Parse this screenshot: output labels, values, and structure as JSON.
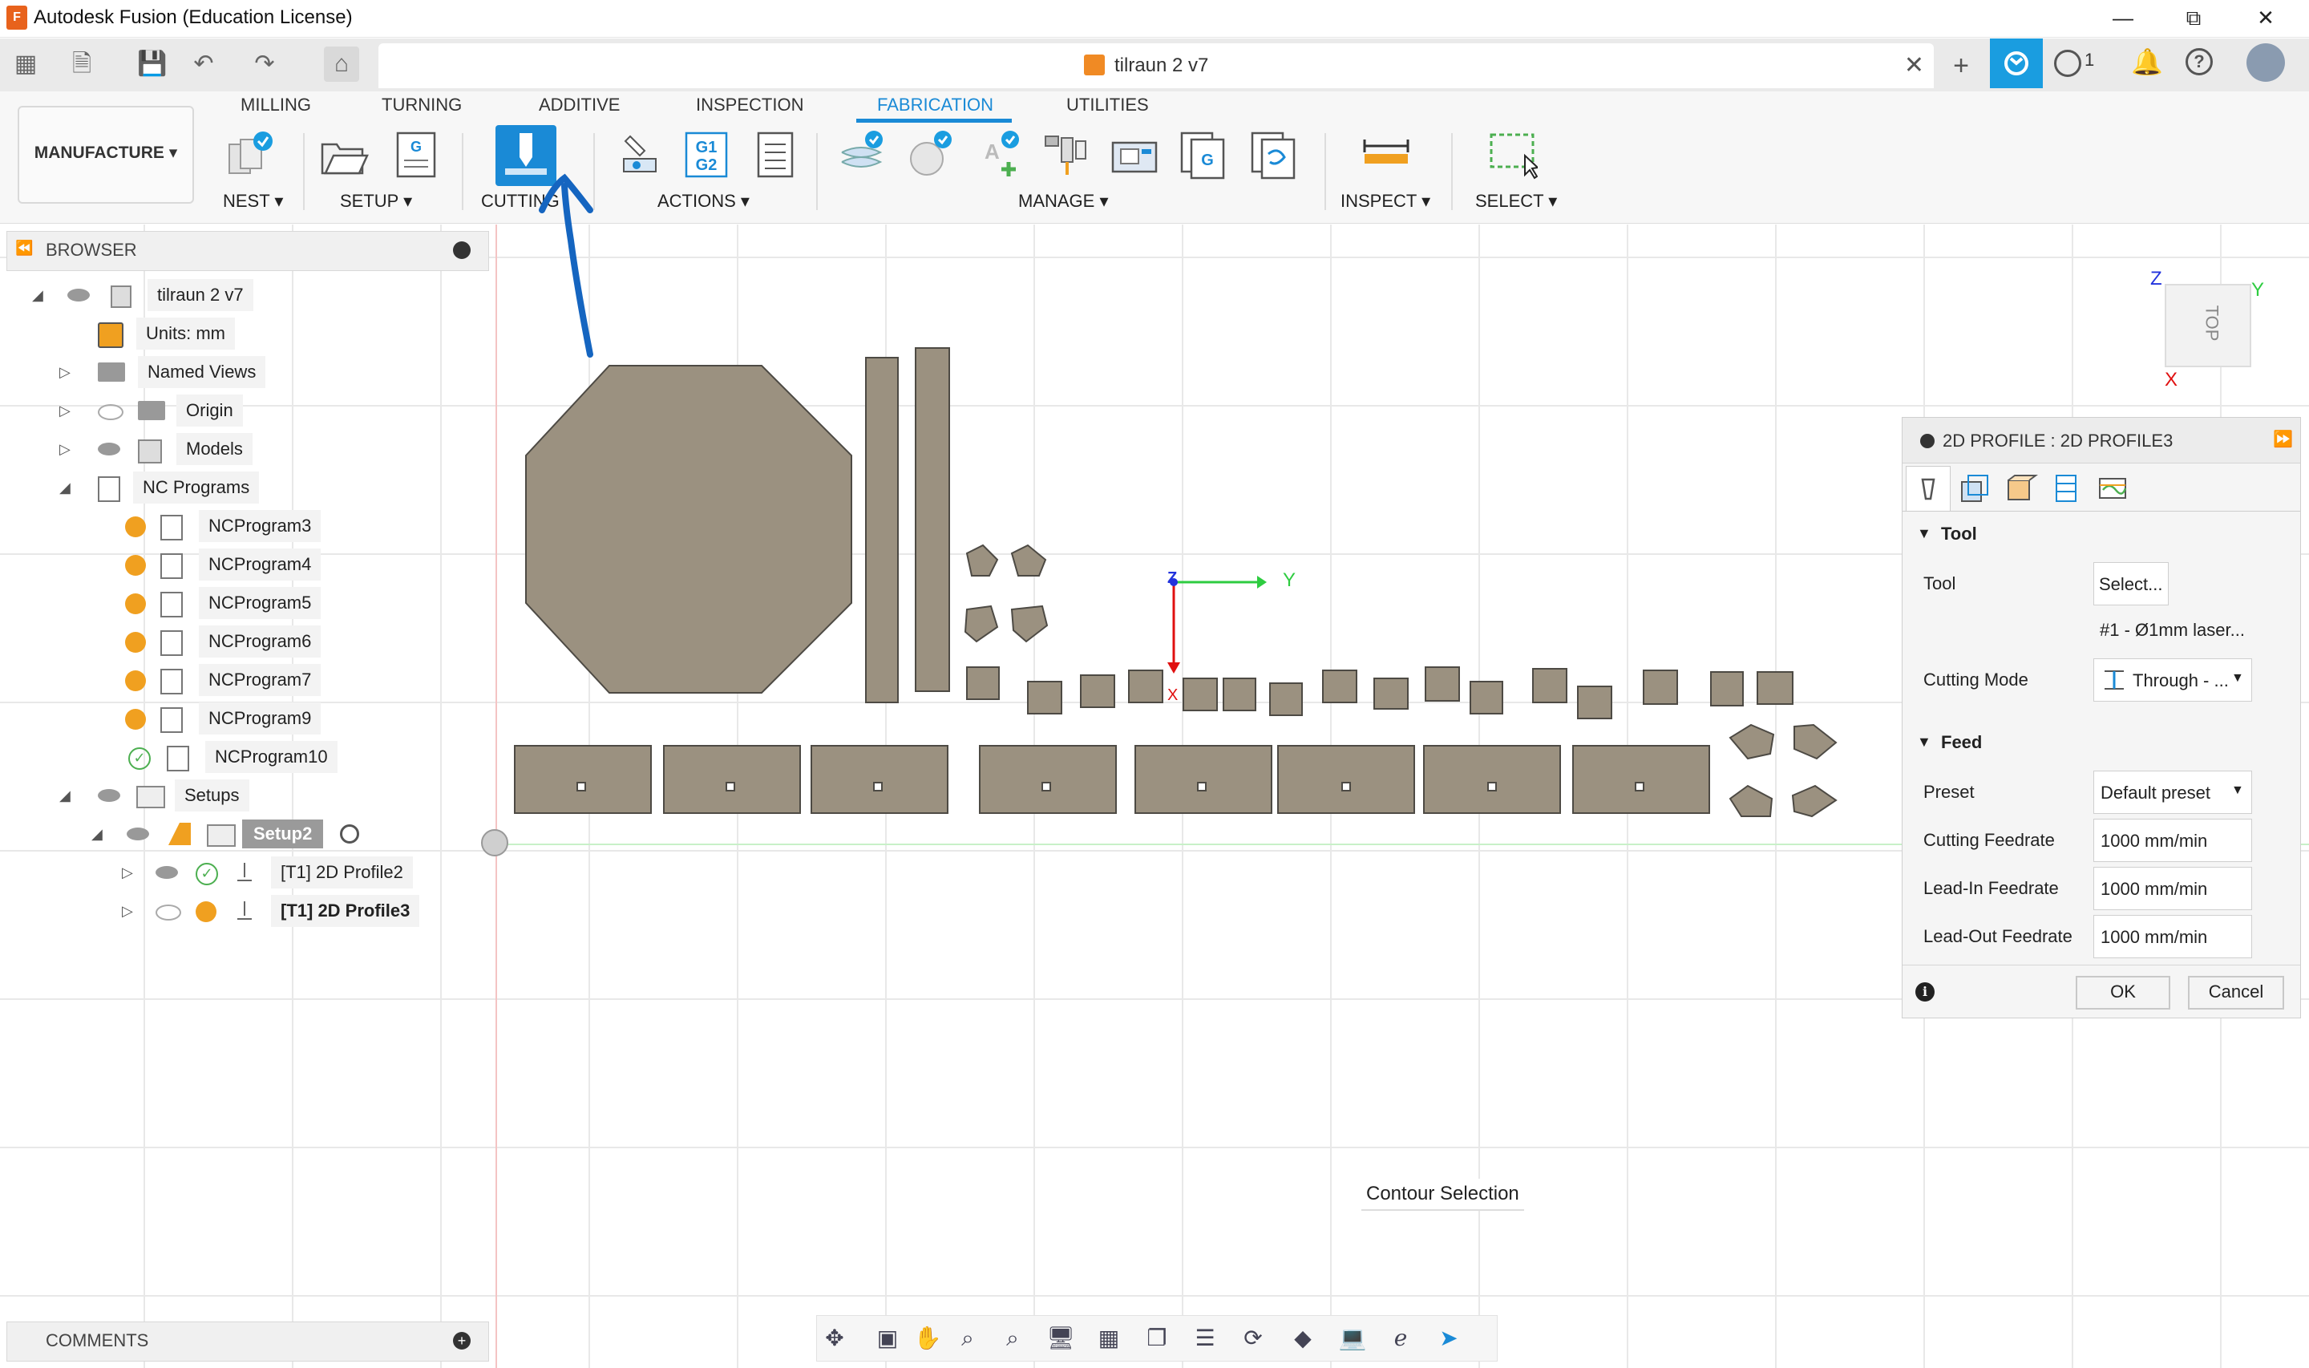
{
  "window": {
    "title": "Autodesk Fusion (Education License)",
    "app_icon_letter": "F"
  },
  "document_tab": {
    "name": "tilraun 2 v7",
    "jobs_count": "1"
  },
  "ribbon": {
    "workspace": "MANUFACTURE ▾",
    "tabs": [
      "MILLING",
      "TURNING",
      "ADDITIVE",
      "INSPECTION",
      "FABRICATION",
      "UTILITIES"
    ],
    "active_tab": "FABRICATION",
    "groups": {
      "nest": "NEST ▾",
      "setup": "SETUP ▾",
      "cutting": "CUTTING",
      "actions": "ACTIONS ▾",
      "manage": "MANAGE ▾",
      "inspect": "INSPECT ▾",
      "select": "SELECT ▾"
    },
    "gcode_icon_text": "G1 G2"
  },
  "browser": {
    "header": "BROWSER",
    "items": [
      {
        "label": "tilraun 2 v7"
      },
      {
        "label": "Units: mm"
      },
      {
        "label": "Named Views"
      },
      {
        "label": "Origin"
      },
      {
        "label": "Models"
      },
      {
        "label": "NC Programs"
      },
      {
        "label": "NCProgram3"
      },
      {
        "label": "NCProgram4"
      },
      {
        "label": "NCProgram5"
      },
      {
        "label": "NCProgram6"
      },
      {
        "label": "NCProgram7"
      },
      {
        "label": "NCProgram9"
      },
      {
        "label": "NCProgram10"
      },
      {
        "label": "Setups"
      },
      {
        "label": "Setup2"
      },
      {
        "label": "[T1] 2D Profile2"
      },
      {
        "label": "[T1] 2D Profile3"
      }
    ]
  },
  "comments": {
    "label": "COMMENTS"
  },
  "viewcube": {
    "face": "TOP",
    "z": "Z",
    "y": "Y",
    "x": "X"
  },
  "triad": {
    "z": "Z",
    "y": "Y",
    "x": "X"
  },
  "tooltip": "Contour Selection",
  "panel": {
    "title": "2D PROFILE : 2D PROFILE3",
    "tool_section": "Tool",
    "tool_label": "Tool",
    "tool_button": "Select...",
    "tool_name": "#1 - Ø1mm laser...",
    "cutting_mode_label": "Cutting Mode",
    "cutting_mode_value": "Through - ...",
    "feed_section": "Feed",
    "preset_label": "Preset",
    "preset_value": "Default preset",
    "cutting_feedrate_label": "Cutting Feedrate",
    "cutting_feedrate_value": "1000 mm/min",
    "leadin_label": "Lead-In Feedrate",
    "leadin_value": "1000 mm/min",
    "leadout_label": "Lead-Out Feedrate",
    "leadout_value": "1000 mm/min",
    "ok": "OK",
    "cancel": "Cancel"
  },
  "colors": {
    "accent": "#1a8ad6",
    "part_fill": "#9b9180",
    "part_stroke": "#4d4a44",
    "annotation": "#1565c0",
    "warning_orange": "#f0a020",
    "ok_green": "#4caf50"
  }
}
